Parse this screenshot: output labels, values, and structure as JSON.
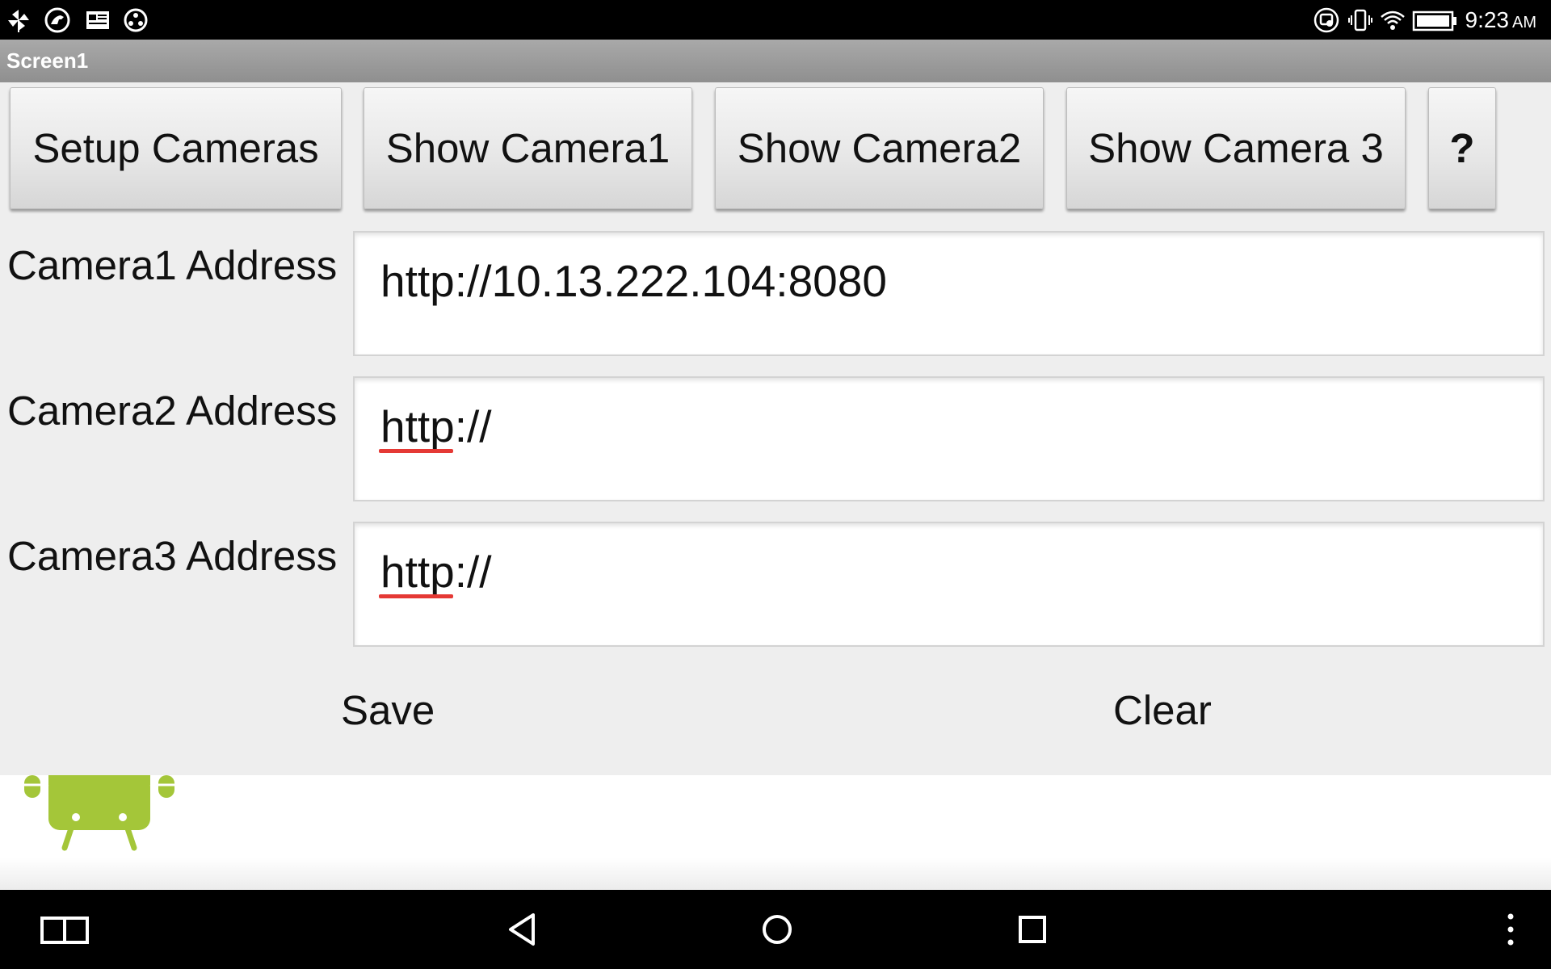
{
  "status_bar": {
    "time": "9:23",
    "ampm": "AM",
    "left_icons": [
      "pinwheel-icon",
      "dinosaur-app-icon",
      "news-icon",
      "game-controller-icon"
    ],
    "right_icons": [
      "cast-icon",
      "vibrate-icon",
      "wifi-icon",
      "battery-icon"
    ]
  },
  "title_bar": {
    "title": "Screen1"
  },
  "toolbar": {
    "setup_label": "Setup Cameras",
    "show_camera1_label": "Show Camera1",
    "show_camera2_label": "Show Camera2",
    "show_camera3_label": "Show Camera 3",
    "help_label": "?"
  },
  "form": {
    "camera1": {
      "label": "Camera1 Address",
      "value": "http://10.13.222.104:8080"
    },
    "camera2": {
      "label": "Camera2 Address",
      "value": "http://"
    },
    "camera3": {
      "label": "Camera3 Address",
      "value": "http://"
    }
  },
  "actions": {
    "save_label": "Save",
    "clear_label": "Clear"
  },
  "nav_bar": {
    "icons": [
      "recent-apps-icon",
      "back-icon",
      "home-icon",
      "overview-icon",
      "overflow-menu-icon"
    ]
  },
  "colors": {
    "title_bar": "#9e9e9e",
    "content_bg": "#eeeeee",
    "spell_underline": "#e53935",
    "android_green": "#a4c639"
  }
}
